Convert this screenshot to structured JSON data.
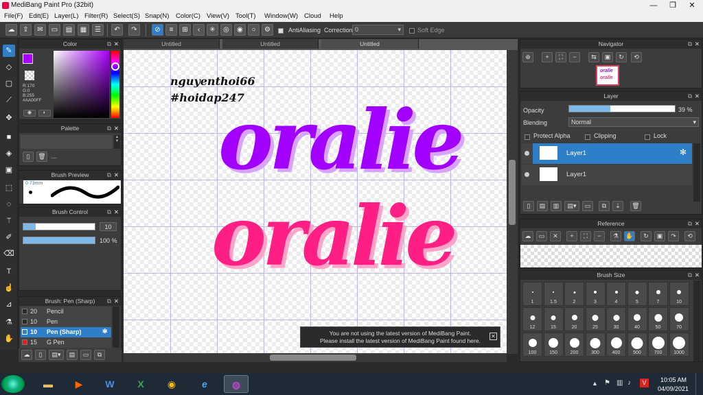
{
  "window": {
    "title": "MediBang Paint Pro (32bit)",
    "minimize": "—",
    "maximize": "❐",
    "close": "✕"
  },
  "menu": [
    "File(F)",
    "Edit(E)",
    "Layer(L)",
    "Filter(R)",
    "Select(S)",
    "Snap(N)",
    "Color(C)",
    "View(V)",
    "Tool(T)",
    "Window(W)",
    "Cloud",
    "Help"
  ],
  "toolbar": {
    "antialiasing_label": "AntiAliasing",
    "correction_label": "Correction",
    "correction_value": "0",
    "soft_edge_label": "Soft Edge"
  },
  "color_panel": {
    "title": "Color",
    "r": "R:170",
    "g": "G:0",
    "b": "B:255",
    "hex": "#AA00FF",
    "primary_color": "#aa00ff"
  },
  "palette_panel": {
    "title": "Palette",
    "dash": "---"
  },
  "brush_preview": {
    "title": "Brush Preview",
    "size": "0.73mm"
  },
  "brush_control": {
    "title": "Brush Control",
    "size_value": "10",
    "opacity_value": "100 %"
  },
  "brush_list": {
    "title": "Brush: Pen (Sharp)",
    "items": [
      {
        "size": "20",
        "name": "Pencil",
        "color": "#2a2a2a"
      },
      {
        "size": "10",
        "name": "Pen",
        "color": "#2a2a2a"
      },
      {
        "size": "10",
        "name": "Pen (Sharp)",
        "color": "#2f7fc8"
      },
      {
        "size": "15",
        "name": "G Pen",
        "color": "#e02020"
      }
    ]
  },
  "document_tabs": [
    "Untitled",
    "Untitled",
    "Untitled"
  ],
  "canvas": {
    "signature_line1": "nguyenthoi66",
    "signature_line2": "#hoidap247",
    "word_top": "oralie",
    "word_bottom": "oralie",
    "word_top_color": "#a100ff",
    "word_bottom_color": "#ff1f84"
  },
  "notice": {
    "line1": "You are not using the latest version of MediBang Paint.",
    "line2": "Please install the latest version of MediBang Paint found here.",
    "close": "✕"
  },
  "navigator": {
    "title": "Navigator"
  },
  "layer_panel": {
    "title": "Layer",
    "opacity_label": "Opacity",
    "opacity_value": "39 %",
    "opacity_fraction": 0.39,
    "blending_label": "Blending",
    "blending_value": "Normal",
    "protect_alpha": "Protect Alpha",
    "clipping": "Clipping",
    "lock": "Lock",
    "layers": [
      {
        "name": "Layer1",
        "selected": true
      },
      {
        "name": "Layer1",
        "selected": false
      }
    ]
  },
  "reference": {
    "title": "Reference"
  },
  "brush_size": {
    "title": "Brush Size",
    "sizes": [
      "1",
      "1.5",
      "2",
      "3",
      "4",
      "5",
      "7",
      "10",
      "12",
      "15",
      "20",
      "25",
      "30",
      "40",
      "50",
      "70",
      "100",
      "150",
      "200",
      "300",
      "400",
      "500",
      "700",
      "1000"
    ]
  },
  "taskbar": {
    "time": "10:05 AM",
    "date": "04/09/2021"
  }
}
